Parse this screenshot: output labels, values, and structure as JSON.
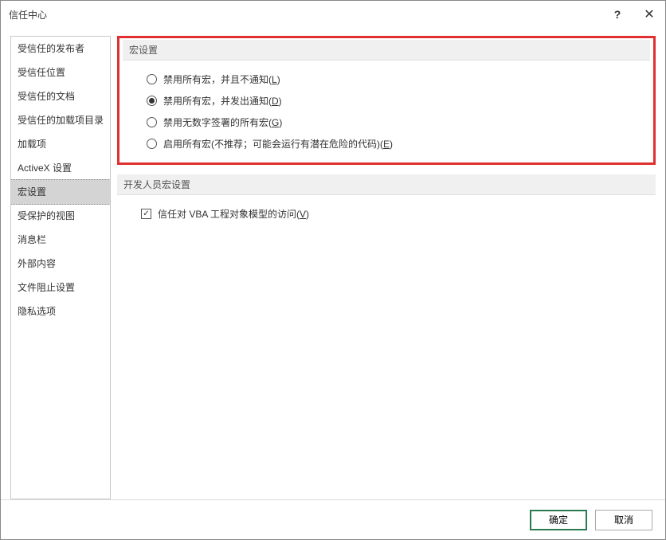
{
  "title": "信任中心",
  "sidebar": {
    "items": [
      "受信任的发布者",
      "受信任位置",
      "受信任的文档",
      "受信任的加载项目录",
      "加载项",
      "ActiveX 设置",
      "宏设置",
      "受保护的视图",
      "消息栏",
      "外部内容",
      "文件阻止设置",
      "隐私选项"
    ],
    "selectedIndex": 6
  },
  "sections": {
    "macro": {
      "header": "宏设置",
      "options": [
        {
          "label_pre": "禁用所有宏，并且不通知(",
          "hotkey": "L",
          "label_post": ")",
          "checked": false
        },
        {
          "label_pre": "禁用所有宏，并发出通知(",
          "hotkey": "D",
          "label_post": ")",
          "checked": true
        },
        {
          "label_pre": "禁用无数字签署的所有宏(",
          "hotkey": "G",
          "label_post": ")",
          "checked": false
        },
        {
          "label_pre": "启用所有宏(不推荐；可能会运行有潜在危险的代码)(",
          "hotkey": "E",
          "label_post": ")",
          "checked": false
        }
      ]
    },
    "dev": {
      "header": "开发人员宏设置",
      "checkbox": {
        "label_pre": "信任对 VBA 工程对象模型的访问(",
        "hotkey": "V",
        "label_post": ")",
        "checked": true
      }
    }
  },
  "buttons": {
    "ok": "确定",
    "cancel": "取消"
  }
}
